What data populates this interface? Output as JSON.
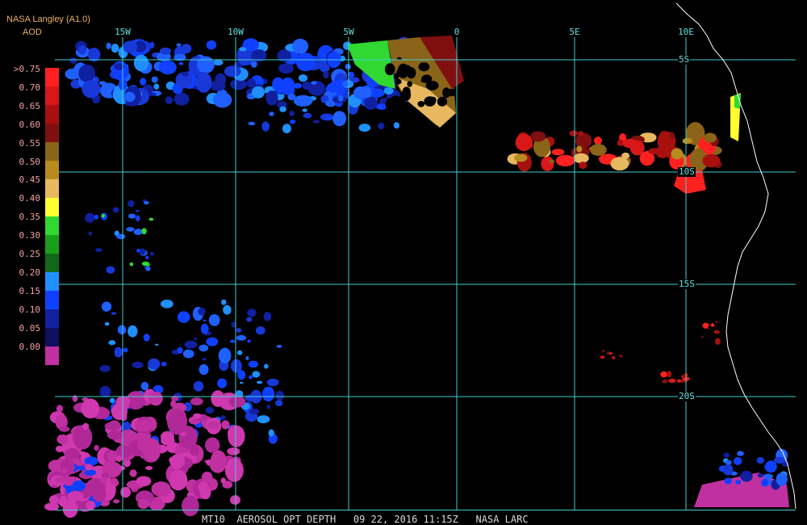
{
  "header": {
    "title": "NASA Langley (A1.0)",
    "product": "AOD"
  },
  "legend": {
    "ticks": [
      ">0.75",
      "0.70",
      "0.65",
      "0.60",
      "0.55",
      "0.50",
      "0.45",
      "0.40",
      "0.35",
      "0.30",
      "0.25",
      "0.20",
      "0.15",
      "0.10",
      "0.05",
      "0.00"
    ],
    "colors": [
      "#ff2020",
      "#d81818",
      "#a81010",
      "#801010",
      "#8a6418",
      "#b88a20",
      "#e8b860",
      "#ffff30",
      "#30d830",
      "#18a018",
      "#106818",
      "#2090ff",
      "#1040ff",
      "#1020a0",
      "#101060",
      "#c030a0"
    ]
  },
  "axes": {
    "longitudes": [
      "15W",
      "10W",
      "5W",
      "0",
      "5E",
      "10E"
    ],
    "latitudes": [
      "5S",
      "10S",
      "15S",
      "20S"
    ]
  },
  "footer": {
    "text": "MT10  AEROSOL OPT DEPTH   09 22, 2016 11:15Z   NASA LARC"
  },
  "colors": {
    "grid": "#40d0d0",
    "coastline": "#ffffff",
    "background": "#000000"
  }
}
